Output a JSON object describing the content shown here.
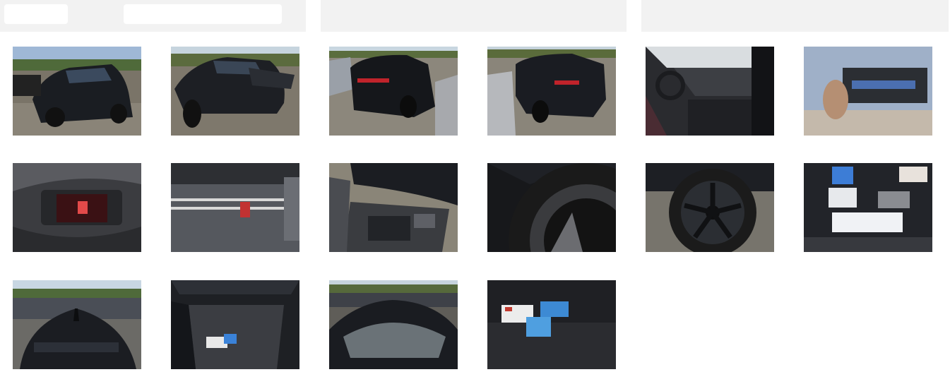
{
  "header": {
    "field_1_value": "",
    "field_2_value": ""
  },
  "gallery": {
    "photos": [
      {
        "subject": "car-front-three-quarter"
      },
      {
        "subject": "car-front-side"
      },
      {
        "subject": "car-rear-three-quarter"
      },
      {
        "subject": "car-rear"
      },
      {
        "subject": "car-interior-dashboard"
      },
      {
        "subject": "windshield-vin-label"
      },
      {
        "subject": "instrument-cluster"
      },
      {
        "subject": "rear-seat"
      },
      {
        "subject": "engine-bay"
      },
      {
        "subject": "tire-closeup"
      },
      {
        "subject": "wheel-closeup"
      },
      {
        "subject": "trunk-documents"
      },
      {
        "subject": "car-roof-rear"
      },
      {
        "subject": "open-trunk"
      },
      {
        "subject": "windshield-front"
      },
      {
        "subject": "trunk-accessories"
      }
    ]
  }
}
